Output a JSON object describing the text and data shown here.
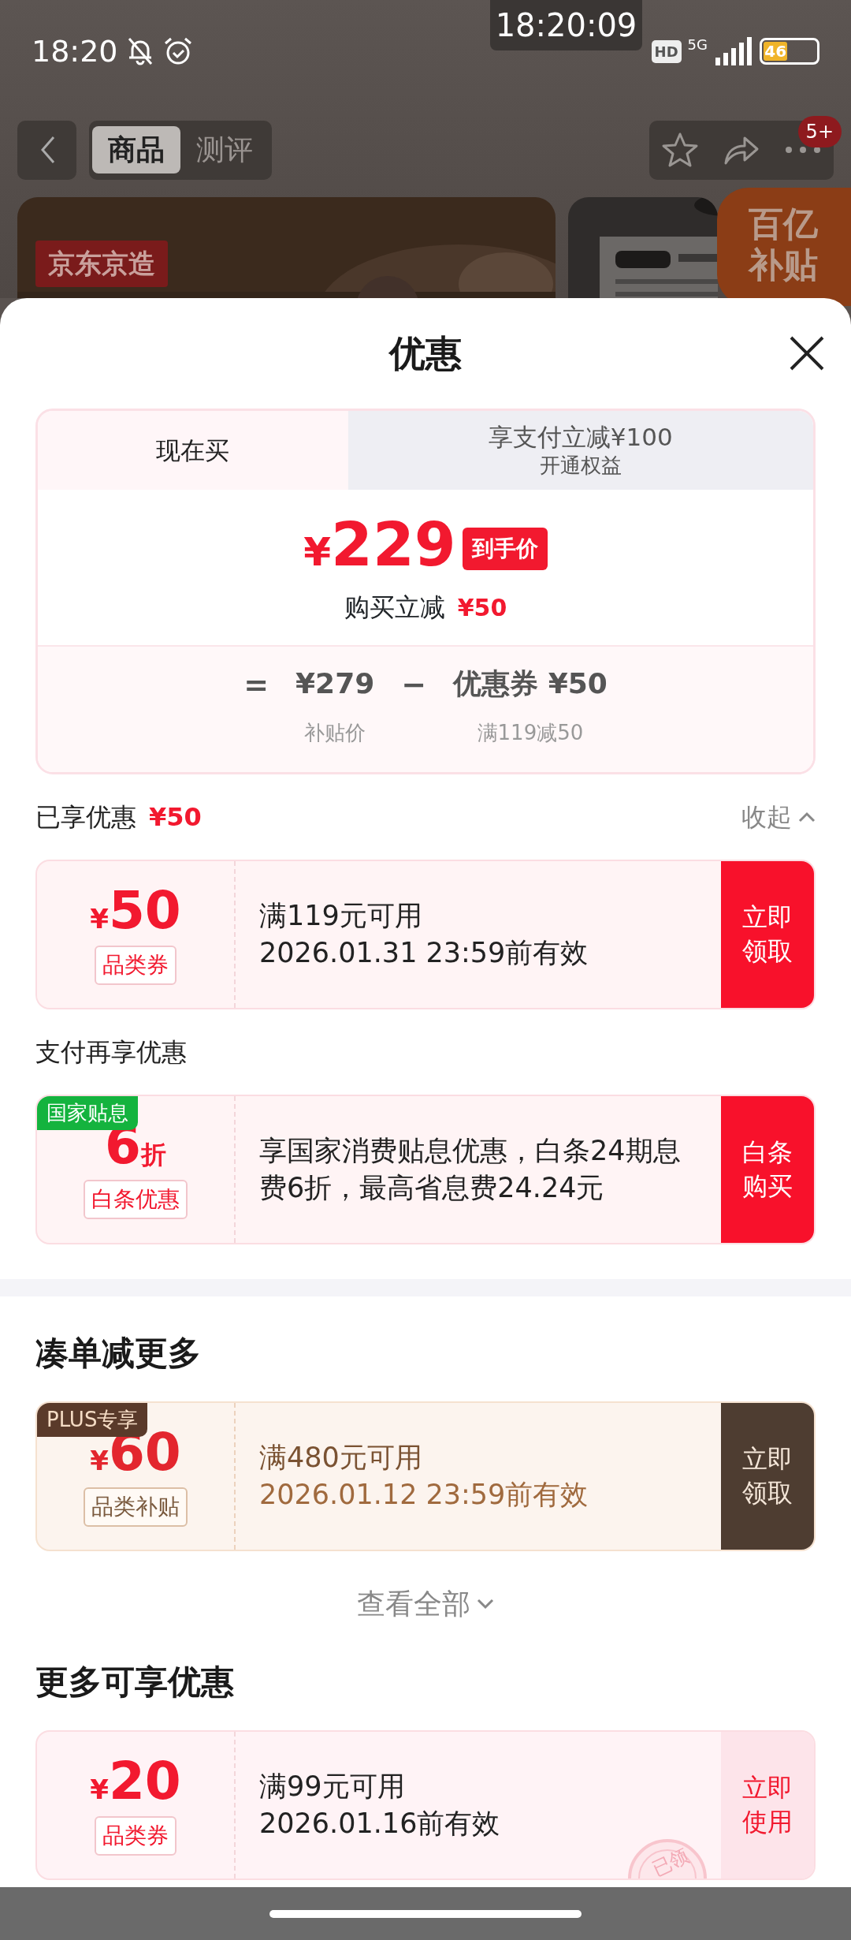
{
  "status_bar": {
    "time": "18:20",
    "clock_overlay": "18:20:09",
    "hd": "HD",
    "network": "5G",
    "battery": "46"
  },
  "header": {
    "tabs": [
      {
        "label": "商品",
        "selected": true
      },
      {
        "label": "测评",
        "selected": false
      }
    ],
    "badge": "5+"
  },
  "backdrop": {
    "brand_label": "京东京造",
    "subsidy_badge": [
      "百亿",
      "补贴"
    ]
  },
  "sheet": {
    "title": "优惠",
    "price_card": {
      "tabs": [
        {
          "label": "现在买",
          "selected": true
        },
        {
          "label": "享支付立减¥100",
          "sublabel": "开通权益",
          "selected": false
        }
      ],
      "currency": "¥",
      "price": "229",
      "price_tag": "到手价",
      "discount_label": "购买立减",
      "discount_value": "¥50",
      "formula": [
        {
          "kind": "op",
          "text": "="
        },
        {
          "kind": "term",
          "value": "¥279",
          "caption": "补贴价"
        },
        {
          "kind": "op",
          "text": "−"
        },
        {
          "kind": "term",
          "value": "优惠券 ¥50",
          "caption": "满119减50"
        }
      ]
    },
    "blocks": [
      {
        "kind": "subheading",
        "text": "已享优惠",
        "value": "¥50",
        "toggle": "收起"
      },
      {
        "kind": "coupon",
        "coupon": {
          "kind": "red",
          "currency": "¥",
          "amount": "50",
          "category": "品类券",
          "condition": "满119元可用",
          "validity": "2026.01.31 23:59前有效",
          "action": [
            "立即",
            "领取"
          ]
        }
      },
      {
        "kind": "subheading",
        "text": "支付再享优惠"
      },
      {
        "kind": "coupon",
        "coupon": {
          "kind": "red",
          "tag": "国家贴息",
          "amount": "6",
          "unit": "折",
          "category": "白条优惠",
          "condition": "享国家消费贴息优惠，白条24期息费6折，最高省息费24.24元",
          "action": [
            "白条",
            "购买"
          ]
        }
      },
      {
        "kind": "divider"
      },
      {
        "kind": "heading",
        "text": "凑单减更多"
      },
      {
        "kind": "coupon",
        "coupon": {
          "kind": "plus",
          "tag": "PLUS专享",
          "currency": "¥",
          "amount": "60",
          "category": "品类补贴",
          "condition": "满480元可用",
          "validity": "2026.01.12 23:59前有效",
          "action": [
            "立即",
            "领取"
          ]
        }
      },
      {
        "kind": "more",
        "text": "查看全部"
      },
      {
        "kind": "heading",
        "text": "更多可享优惠"
      },
      {
        "kind": "coupon",
        "coupon": {
          "kind": "pink",
          "currency": "¥",
          "amount": "20",
          "category": "品类券",
          "condition": "满99元可用",
          "validity": "2026.01.16前有效",
          "action": [
            "立即",
            "使用"
          ],
          "stamp": "已领"
        }
      }
    ]
  }
}
